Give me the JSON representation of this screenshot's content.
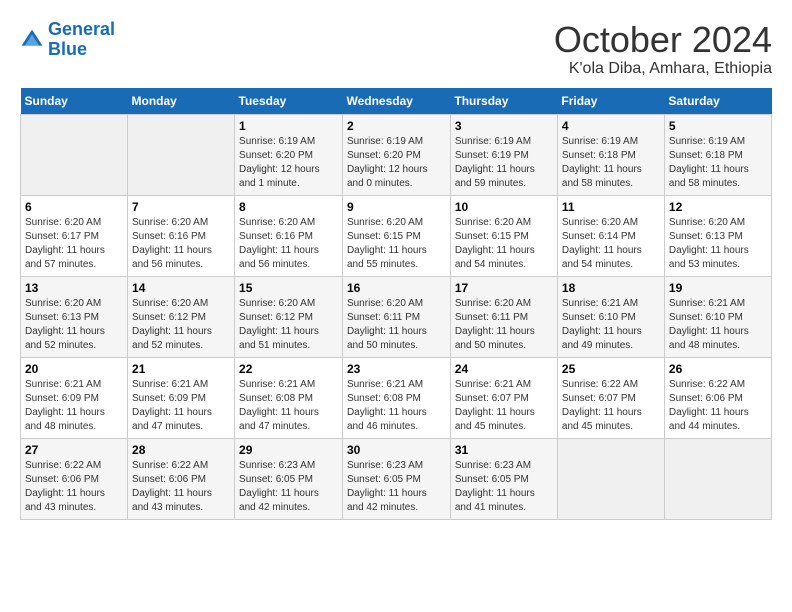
{
  "logo": {
    "line1": "General",
    "line2": "Blue"
  },
  "title": "October 2024",
  "subtitle": "K'ola Diba, Amhara, Ethiopia",
  "headers": [
    "Sunday",
    "Monday",
    "Tuesday",
    "Wednesday",
    "Thursday",
    "Friday",
    "Saturday"
  ],
  "weeks": [
    [
      {
        "day": "",
        "content": ""
      },
      {
        "day": "",
        "content": ""
      },
      {
        "day": "1",
        "content": "Sunrise: 6:19 AM\nSunset: 6:20 PM\nDaylight: 12 hours\nand 1 minute."
      },
      {
        "day": "2",
        "content": "Sunrise: 6:19 AM\nSunset: 6:20 PM\nDaylight: 12 hours\nand 0 minutes."
      },
      {
        "day": "3",
        "content": "Sunrise: 6:19 AM\nSunset: 6:19 PM\nDaylight: 11 hours\nand 59 minutes."
      },
      {
        "day": "4",
        "content": "Sunrise: 6:19 AM\nSunset: 6:18 PM\nDaylight: 11 hours\nand 58 minutes."
      },
      {
        "day": "5",
        "content": "Sunrise: 6:19 AM\nSunset: 6:18 PM\nDaylight: 11 hours\nand 58 minutes."
      }
    ],
    [
      {
        "day": "6",
        "content": "Sunrise: 6:20 AM\nSunset: 6:17 PM\nDaylight: 11 hours\nand 57 minutes."
      },
      {
        "day": "7",
        "content": "Sunrise: 6:20 AM\nSunset: 6:16 PM\nDaylight: 11 hours\nand 56 minutes."
      },
      {
        "day": "8",
        "content": "Sunrise: 6:20 AM\nSunset: 6:16 PM\nDaylight: 11 hours\nand 56 minutes."
      },
      {
        "day": "9",
        "content": "Sunrise: 6:20 AM\nSunset: 6:15 PM\nDaylight: 11 hours\nand 55 minutes."
      },
      {
        "day": "10",
        "content": "Sunrise: 6:20 AM\nSunset: 6:15 PM\nDaylight: 11 hours\nand 54 minutes."
      },
      {
        "day": "11",
        "content": "Sunrise: 6:20 AM\nSunset: 6:14 PM\nDaylight: 11 hours\nand 54 minutes."
      },
      {
        "day": "12",
        "content": "Sunrise: 6:20 AM\nSunset: 6:13 PM\nDaylight: 11 hours\nand 53 minutes."
      }
    ],
    [
      {
        "day": "13",
        "content": "Sunrise: 6:20 AM\nSunset: 6:13 PM\nDaylight: 11 hours\nand 52 minutes."
      },
      {
        "day": "14",
        "content": "Sunrise: 6:20 AM\nSunset: 6:12 PM\nDaylight: 11 hours\nand 52 minutes."
      },
      {
        "day": "15",
        "content": "Sunrise: 6:20 AM\nSunset: 6:12 PM\nDaylight: 11 hours\nand 51 minutes."
      },
      {
        "day": "16",
        "content": "Sunrise: 6:20 AM\nSunset: 6:11 PM\nDaylight: 11 hours\nand 50 minutes."
      },
      {
        "day": "17",
        "content": "Sunrise: 6:20 AM\nSunset: 6:11 PM\nDaylight: 11 hours\nand 50 minutes."
      },
      {
        "day": "18",
        "content": "Sunrise: 6:21 AM\nSunset: 6:10 PM\nDaylight: 11 hours\nand 49 minutes."
      },
      {
        "day": "19",
        "content": "Sunrise: 6:21 AM\nSunset: 6:10 PM\nDaylight: 11 hours\nand 48 minutes."
      }
    ],
    [
      {
        "day": "20",
        "content": "Sunrise: 6:21 AM\nSunset: 6:09 PM\nDaylight: 11 hours\nand 48 minutes."
      },
      {
        "day": "21",
        "content": "Sunrise: 6:21 AM\nSunset: 6:09 PM\nDaylight: 11 hours\nand 47 minutes."
      },
      {
        "day": "22",
        "content": "Sunrise: 6:21 AM\nSunset: 6:08 PM\nDaylight: 11 hours\nand 47 minutes."
      },
      {
        "day": "23",
        "content": "Sunrise: 6:21 AM\nSunset: 6:08 PM\nDaylight: 11 hours\nand 46 minutes."
      },
      {
        "day": "24",
        "content": "Sunrise: 6:21 AM\nSunset: 6:07 PM\nDaylight: 11 hours\nand 45 minutes."
      },
      {
        "day": "25",
        "content": "Sunrise: 6:22 AM\nSunset: 6:07 PM\nDaylight: 11 hours\nand 45 minutes."
      },
      {
        "day": "26",
        "content": "Sunrise: 6:22 AM\nSunset: 6:06 PM\nDaylight: 11 hours\nand 44 minutes."
      }
    ],
    [
      {
        "day": "27",
        "content": "Sunrise: 6:22 AM\nSunset: 6:06 PM\nDaylight: 11 hours\nand 43 minutes."
      },
      {
        "day": "28",
        "content": "Sunrise: 6:22 AM\nSunset: 6:06 PM\nDaylight: 11 hours\nand 43 minutes."
      },
      {
        "day": "29",
        "content": "Sunrise: 6:23 AM\nSunset: 6:05 PM\nDaylight: 11 hours\nand 42 minutes."
      },
      {
        "day": "30",
        "content": "Sunrise: 6:23 AM\nSunset: 6:05 PM\nDaylight: 11 hours\nand 42 minutes."
      },
      {
        "day": "31",
        "content": "Sunrise: 6:23 AM\nSunset: 6:05 PM\nDaylight: 11 hours\nand 41 minutes."
      },
      {
        "day": "",
        "content": ""
      },
      {
        "day": "",
        "content": ""
      }
    ]
  ]
}
